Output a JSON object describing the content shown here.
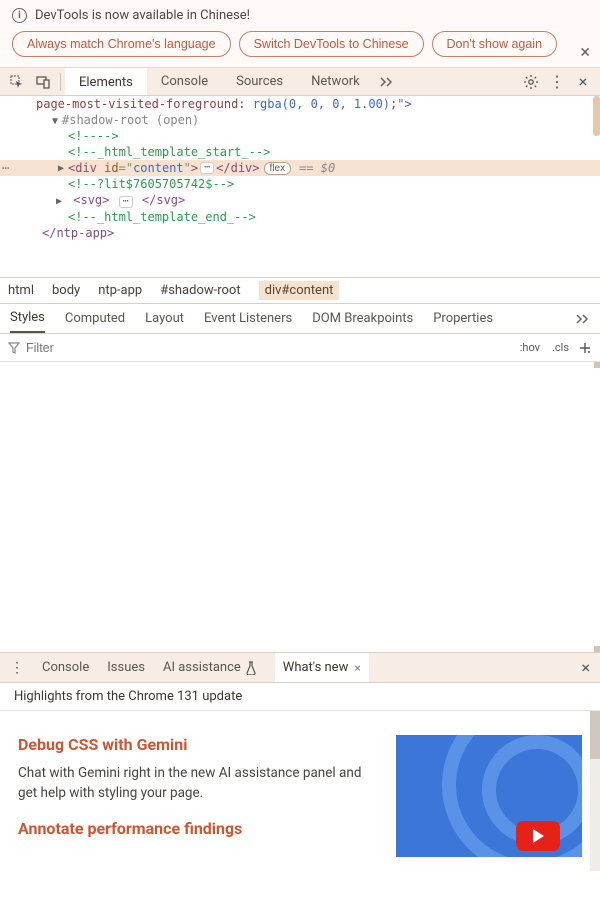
{
  "infobar": {
    "message": "DevTools is now available in Chinese!",
    "btn_match": "Always match Chrome's language",
    "btn_switch": "Switch DevTools to Chinese",
    "btn_dont": "Don't show again"
  },
  "tabs": {
    "elements": "Elements",
    "console": "Console",
    "sources": "Sources",
    "network": "Network"
  },
  "elements": {
    "style_fragment_pre": "page-most-visited-foreground",
    "style_fragment_val": "rgba(0, 0, 0, 1.00)",
    "shadow_root": "#shadow-root (open)",
    "comment_empty": "<!---->",
    "comment_start": "<!--_html_template_start_-->",
    "div_open_tag": "div",
    "div_id_attr": "id",
    "div_id_val": "content",
    "flex_badge": "flex",
    "eq0": "== $0",
    "comment_lit": "<!--?lit$7605705742$-->",
    "svg_tag": "svg",
    "comment_end": "<!--_html_template_end_-->",
    "close_ntp": "</ntp-app>"
  },
  "crumbs": {
    "html": "html",
    "body": "body",
    "ntp": "ntp-app",
    "shadow": "#shadow-root",
    "div": "div#content"
  },
  "styles_tabs": {
    "styles": "Styles",
    "computed": "Computed",
    "layout": "Layout",
    "listeners": "Event Listeners",
    "dom_bp": "DOM Breakpoints",
    "properties": "Properties"
  },
  "filter": {
    "placeholder": "Filter",
    "hov": ":hov",
    "cls": ".cls"
  },
  "drawer_tabs": {
    "console": "Console",
    "issues": "Issues",
    "ai": "AI assistance",
    "whatsnew": "What's new"
  },
  "whatsnew": {
    "highlights": "Highlights from the Chrome 131 update",
    "h1": "Debug CSS with Gemini",
    "p1": "Chat with Gemini right in the new AI assistance panel and get help with styling your page.",
    "h2": "Annotate performance findings"
  }
}
